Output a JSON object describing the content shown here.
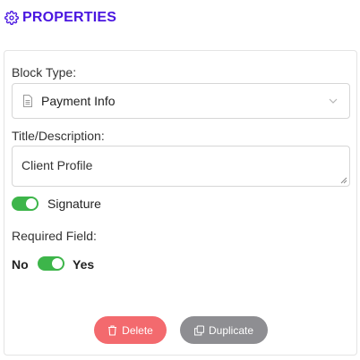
{
  "header": {
    "title": "PROPERTIES",
    "icon": "gear-icon",
    "accent": "#4a16e0"
  },
  "block_type": {
    "label": "Block Type:",
    "selected": "Payment Info",
    "icon": "document-icon"
  },
  "description": {
    "label": "Title/Description:",
    "value": "Client Profile"
  },
  "signature": {
    "label": "Signature",
    "enabled": true,
    "toggle_color": "#3db54a"
  },
  "required": {
    "label": "Required Field:",
    "off_label": "No",
    "on_label": "Yes",
    "enabled": true
  },
  "actions": {
    "delete_label": "Delete",
    "delete_color": "#f36a6e",
    "duplicate_label": "Duplicate",
    "duplicate_color": "#8e8e92"
  }
}
